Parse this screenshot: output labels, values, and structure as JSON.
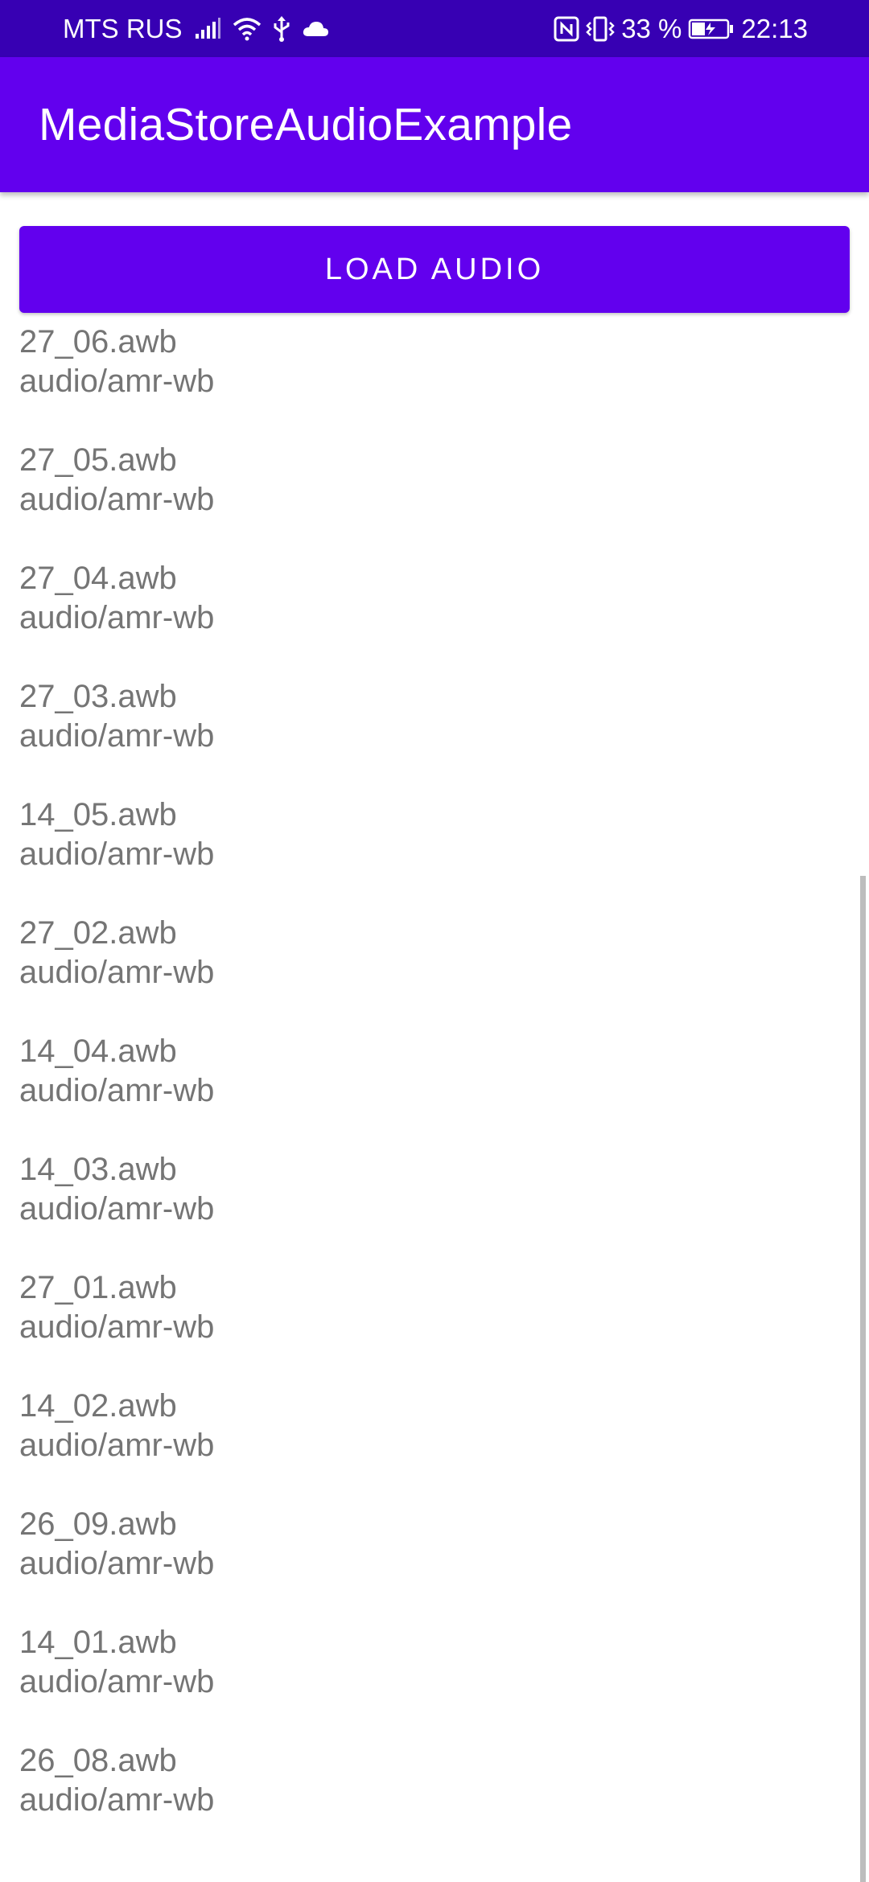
{
  "status_bar": {
    "carrier": "MTS RUS",
    "battery_percent": "33 %",
    "time": "22:13",
    "icons_left": [
      "signal-icon",
      "wifi-icon",
      "usb-icon",
      "cloud-icon"
    ],
    "icons_right": [
      "nfc-icon",
      "vibrate-icon",
      "battery-charging-icon"
    ]
  },
  "app_bar": {
    "title": "MediaStoreAudioExample",
    "color": "#6200ee"
  },
  "load_button": {
    "label": "LOAD AUDIO"
  },
  "audio_items": [
    {
      "name": "27_06.awb",
      "mime": "audio/amr-wb"
    },
    {
      "name": "27_05.awb",
      "mime": "audio/amr-wb"
    },
    {
      "name": "27_04.awb",
      "mime": "audio/amr-wb"
    },
    {
      "name": "27_03.awb",
      "mime": "audio/amr-wb"
    },
    {
      "name": "14_05.awb",
      "mime": "audio/amr-wb"
    },
    {
      "name": "27_02.awb",
      "mime": "audio/amr-wb"
    },
    {
      "name": "14_04.awb",
      "mime": "audio/amr-wb"
    },
    {
      "name": "14_03.awb",
      "mime": "audio/amr-wb"
    },
    {
      "name": "27_01.awb",
      "mime": "audio/amr-wb"
    },
    {
      "name": "14_02.awb",
      "mime": "audio/amr-wb"
    },
    {
      "name": "26_09.awb",
      "mime": "audio/amr-wb"
    },
    {
      "name": "14_01.awb",
      "mime": "audio/amr-wb"
    },
    {
      "name": "26_08.awb",
      "mime": "audio/amr-wb"
    }
  ],
  "colors": {
    "status_bar": "#3700b3",
    "primary": "#6200ee",
    "list_text": "#757575",
    "scrollbar": "#bdbdbd"
  }
}
